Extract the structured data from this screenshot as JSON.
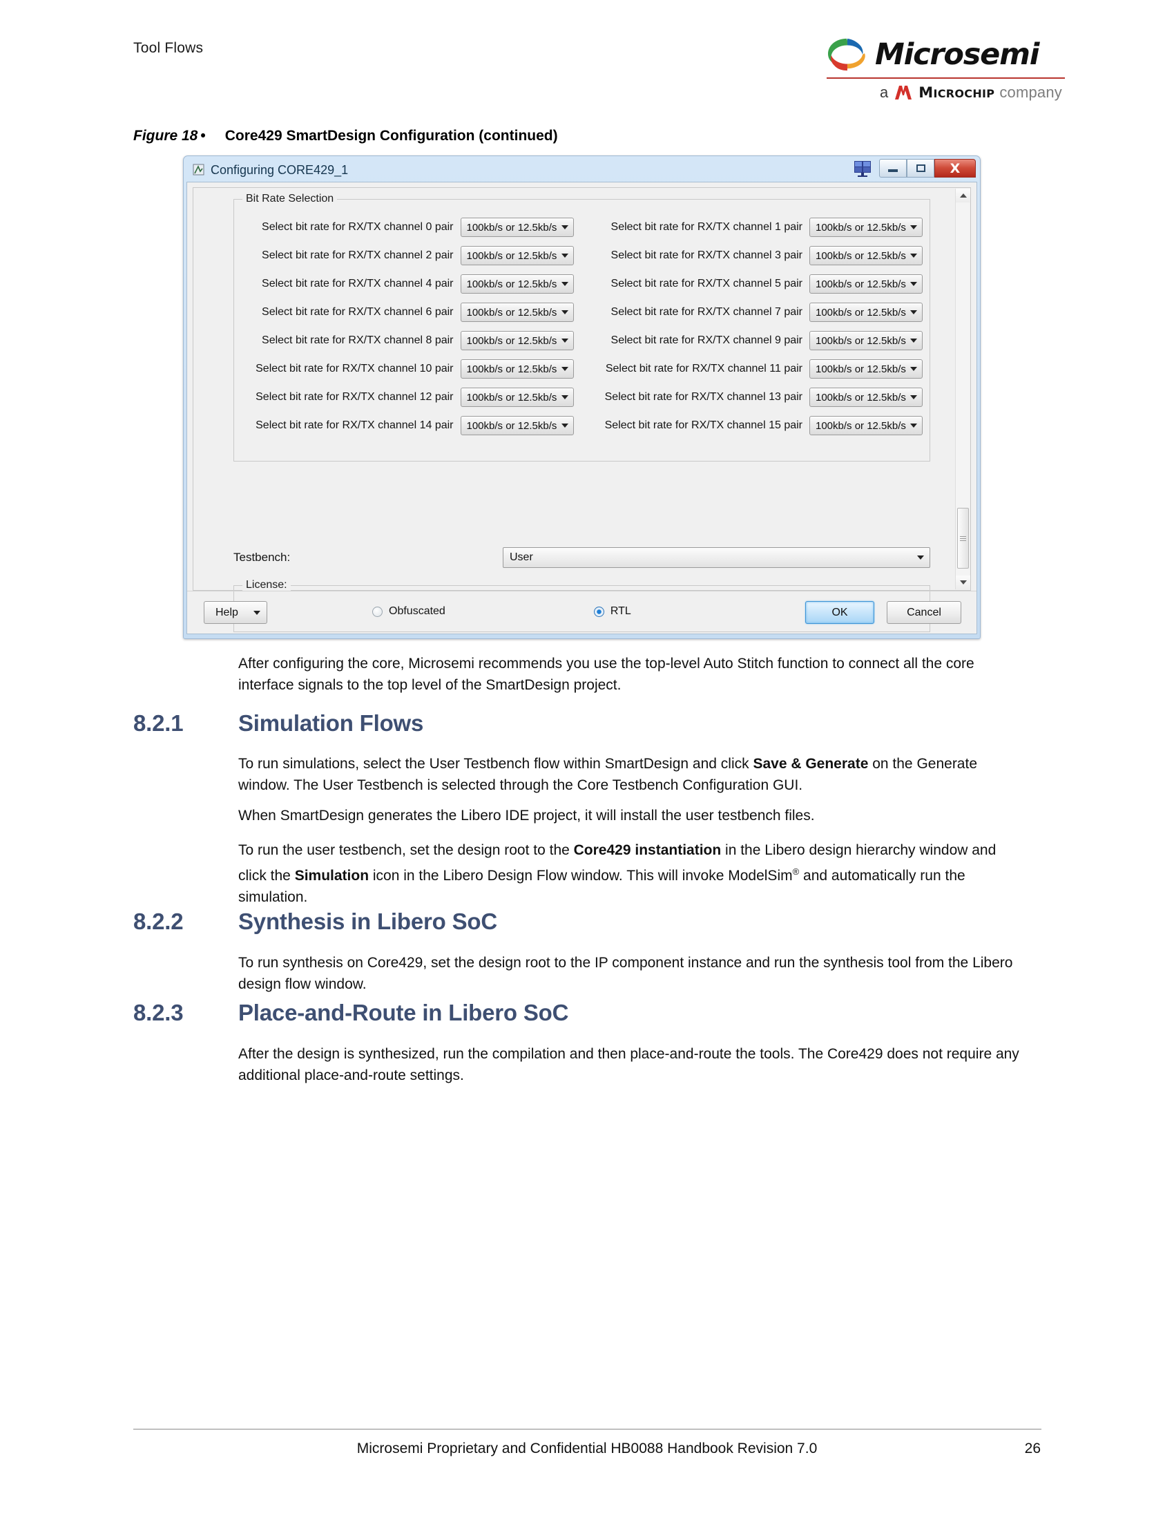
{
  "header": {
    "running_head": "Tool Flows",
    "logo": {
      "wordmark": "Microsemi",
      "a_text": "a",
      "microchip": "M",
      "microchip_rest": "ICROCHIP",
      "company": "company"
    }
  },
  "figure": {
    "number": "Figure 18",
    "bullet": "•",
    "title": "Core429 SmartDesign Configuration (continued)"
  },
  "dialog": {
    "title": "Configuring CORE429_1",
    "close_glyph": "X",
    "bitrate_group_title": "Bit Rate Selection",
    "channels": [
      {
        "label": "Select bit rate for RX/TX channel 0 pair",
        "value": "100kb/s or 12.5kb/s"
      },
      {
        "label": "Select bit rate for RX/TX channel 1 pair",
        "value": "100kb/s or 12.5kb/s"
      },
      {
        "label": "Select bit rate for RX/TX channel 2 pair",
        "value": "100kb/s or 12.5kb/s"
      },
      {
        "label": "Select bit rate for RX/TX channel 3 pair",
        "value": "100kb/s or 12.5kb/s"
      },
      {
        "label": "Select bit rate for RX/TX channel 4 pair",
        "value": "100kb/s or 12.5kb/s"
      },
      {
        "label": "Select bit rate for RX/TX channel 5 pair",
        "value": "100kb/s or 12.5kb/s"
      },
      {
        "label": "Select bit rate for RX/TX channel 6 pair",
        "value": "100kb/s or 12.5kb/s"
      },
      {
        "label": "Select bit rate for RX/TX channel 7 pair",
        "value": "100kb/s or 12.5kb/s"
      },
      {
        "label": "Select bit rate for RX/TX channel 8 pair",
        "value": "100kb/s or 12.5kb/s"
      },
      {
        "label": "Select bit rate for RX/TX channel 9 pair",
        "value": "100kb/s or 12.5kb/s"
      },
      {
        "label": "Select bit rate for RX/TX channel 10 pair",
        "value": "100kb/s or 12.5kb/s"
      },
      {
        "label": "Select bit rate for RX/TX channel 11 pair",
        "value": "100kb/s or 12.5kb/s"
      },
      {
        "label": "Select bit rate for RX/TX channel 12 pair",
        "value": "100kb/s or 12.5kb/s"
      },
      {
        "label": "Select bit rate for RX/TX channel 13 pair",
        "value": "100kb/s or 12.5kb/s"
      },
      {
        "label": "Select bit rate for RX/TX channel 14 pair",
        "value": "100kb/s or 12.5kb/s"
      },
      {
        "label": "Select bit rate for RX/TX channel 15 pair",
        "value": "100kb/s or 12.5kb/s"
      }
    ],
    "testbench_label": "Testbench:",
    "testbench_value": "User",
    "license_group_title": "License:",
    "license_obfuscated": "Obfuscated",
    "license_rtl": "RTL",
    "license_selected": "RTL",
    "help_label": "Help",
    "ok_label": "OK",
    "cancel_label": "Cancel"
  },
  "content": {
    "intro_p1": "After configuring the core, Microsemi recommends you use the top-level Auto Stitch function to connect all the core interface signals to the top level of the SmartDesign project.",
    "sec1_num": "8.2.1",
    "sec1_title": "Simulation Flows",
    "sec1_p1_a": "To run simulations, select the User Testbench flow within SmartDesign and click ",
    "sec1_p1_b": "Save & Generate",
    "sec1_p1_c": " on the Generate window. The User Testbench is selected through the Core Testbench Configuration GUI.",
    "sec1_p2": "When SmartDesign generates the Libero IDE project, it will install the user testbench files.",
    "sec1_p3_a": "To run the user testbench, set the design root to the ",
    "sec1_p3_b": "Core429 instantiation",
    "sec1_p3_c": " in the Libero design hierarchy window and click the ",
    "sec1_p3_d": "Simulation",
    "sec1_p3_e": " icon in the Libero Design Flow window. This will invoke ModelSim",
    "sec1_p3_sup": "®",
    "sec1_p3_f": " and automatically run the simulation.",
    "sec2_num": "8.2.2",
    "sec2_title": "Synthesis in Libero SoC",
    "sec2_p1": "To run synthesis on Core429, set the design root to the IP component instance and run the synthesis tool from the Libero design flow window.",
    "sec3_num": "8.2.3",
    "sec3_title": "Place-and-Route in Libero SoC",
    "sec3_p1": "After the design is synthesized, run the compilation and then place-and-route the tools. The Core429 does not require any additional place-and-route settings."
  },
  "footer": {
    "text": "Microsemi Proprietary and Confidential HB0088 Handbook Revision 7.0",
    "page": "26"
  },
  "colors": {
    "heading": "#3e4f72",
    "logo_rule": "#b9352e",
    "accent_blue": "#1f7fd6"
  }
}
